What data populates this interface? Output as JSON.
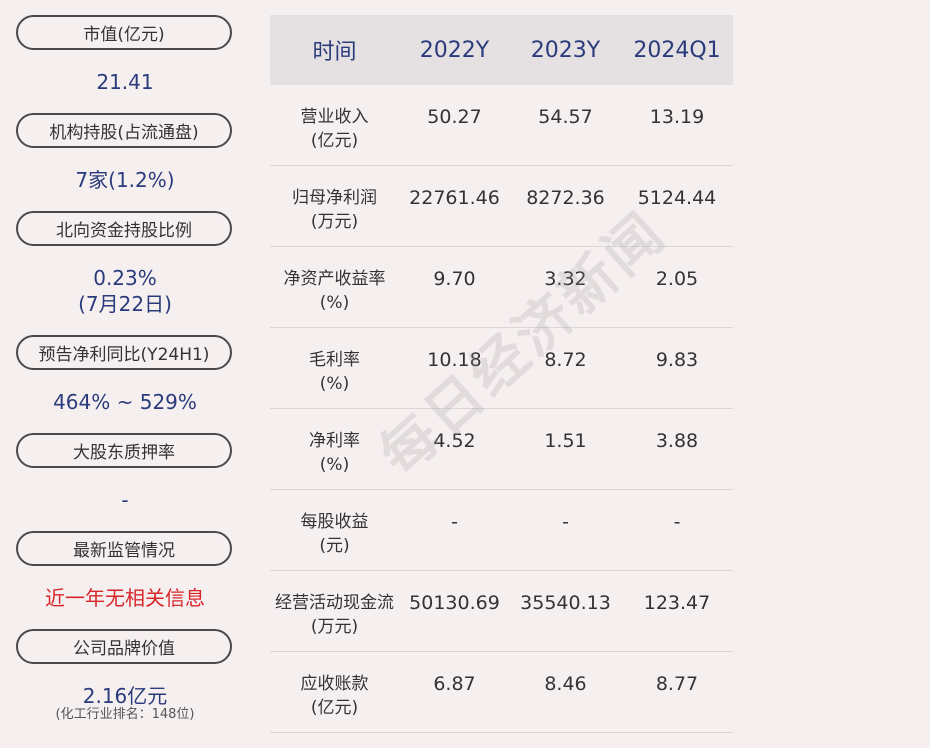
{
  "left": {
    "items": [
      {
        "label": "市值(亿元)",
        "value": "21.41"
      },
      {
        "label": "机构持股(占流通盘)",
        "value": "7家(1.2%)"
      },
      {
        "label": "北向资金持股比例",
        "value": "0.23%",
        "value2": "(7月22日)"
      },
      {
        "label": "预告净利同比(Y24H1)",
        "value": "464% ~ 529%"
      },
      {
        "label": "大股东质押率",
        "value": "-"
      },
      {
        "label": "最新监管情况",
        "value": "近一年无相关信息"
      },
      {
        "label": "公司品牌价值",
        "value": "2.16亿元",
        "note": "(化工行业排名：148位)"
      }
    ]
  },
  "table": {
    "headers": [
      "时间",
      "2022Y",
      "2023Y",
      "2024Q1"
    ],
    "rows": [
      {
        "label1": "营业收入",
        "label2": "(亿元)",
        "v": [
          "50.27",
          "54.57",
          "13.19"
        ]
      },
      {
        "label1": "归母净利润",
        "label2": "(万元)",
        "v": [
          "22761.46",
          "8272.36",
          "5124.44"
        ]
      },
      {
        "label1": "净资产收益率",
        "label2": "(%)",
        "v": [
          "9.70",
          "3.32",
          "2.05"
        ]
      },
      {
        "label1": "毛利率",
        "label2": "(%)",
        "v": [
          "10.18",
          "8.72",
          "9.83"
        ]
      },
      {
        "label1": "净利率",
        "label2": "(%)",
        "v": [
          "4.52",
          "1.51",
          "3.88"
        ]
      },
      {
        "label1": "每股收益",
        "label2": "(元)",
        "v": [
          "-",
          "-",
          "-"
        ]
      },
      {
        "label1": "经营活动现金流",
        "label2": "(万元)",
        "v": [
          "50130.69",
          "35540.13",
          "123.47"
        ]
      },
      {
        "label1": "应收账款",
        "label2": "(亿元)",
        "v": [
          "6.87",
          "8.46",
          "8.77"
        ]
      }
    ]
  },
  "watermark": "每日经济新闻"
}
